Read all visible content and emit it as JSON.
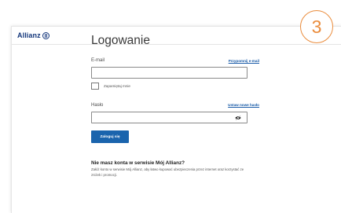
{
  "badge": {
    "number": "3"
  },
  "header": {
    "logo_text": "Allianz"
  },
  "form": {
    "title": "Logowanie",
    "email_label": "E-mail",
    "email_link": "Przypomnij e-mail",
    "email_value": "",
    "remember_label": "Zapamiętaj mnie",
    "password_label": "Hasło",
    "password_link": "Ustaw nowe hasło",
    "password_value": "",
    "submit_label": "Zaloguj się"
  },
  "promo": {
    "title": "Nie masz konta w serwisie Mój Allianz?",
    "text": "Załóż konto w serwisie Mój Allianz, aby łatwo kupować ubezpieczenia przez internet oraz korzystać ze zniżek i promocji."
  },
  "colors": {
    "brand": "#12357a",
    "button": "#1a64ad",
    "link": "#1a5ca8",
    "badge": "#ea8c3c"
  },
  "icons": {
    "password_toggle": "eye-slash-icon"
  }
}
